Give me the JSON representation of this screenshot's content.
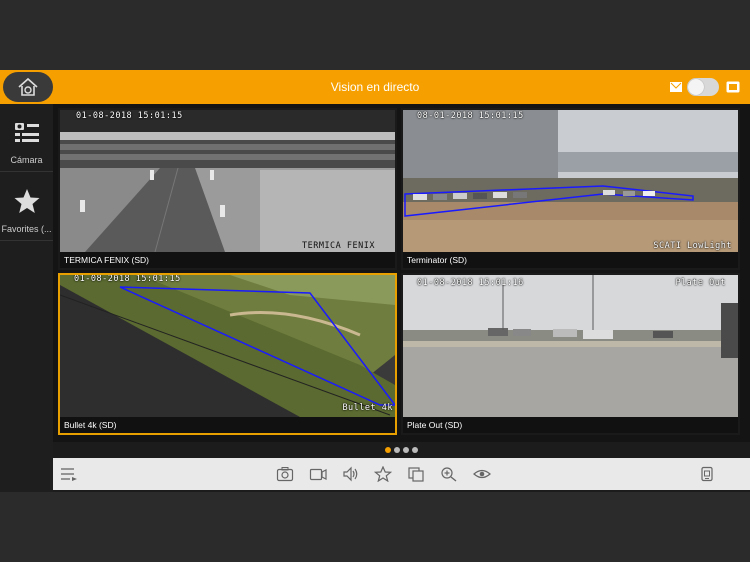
{
  "header": {
    "title": "Vision en directo"
  },
  "sidebar": {
    "items": [
      {
        "label": "Cámara"
      },
      {
        "label": "Favorites (..."
      }
    ]
  },
  "tiles": [
    {
      "caption": "TERMICA FENIX (SD)",
      "timestamp": "01-08-2018 15:01:15",
      "overlay": "TERMICA FENIX"
    },
    {
      "caption": "Terminator (SD)",
      "timestamp": "08-01-2018 15:01:15",
      "overlay": "SCATI LowLight"
    },
    {
      "caption": "Bullet 4k (SD)",
      "timestamp": "01-08-2018 15:01:15",
      "overlay": "Bullet 4k"
    },
    {
      "caption": "Plate Out (SD)",
      "timestamp": "01-08-2018 15:01:16",
      "overlay": "Plate Out"
    }
  ],
  "pager": {
    "page_count": 4,
    "active_page": 1
  },
  "toolbar": {
    "icons": [
      "menu-icon",
      "snapshot-icon",
      "record-icon",
      "audio-icon",
      "favorite-icon",
      "copy-icon",
      "zoom-in-icon",
      "view-icon",
      "device-icon"
    ]
  },
  "colors": {
    "accent": "#f5a000",
    "selected_border": "#e8a000",
    "overlay_line": "#1a1aff"
  }
}
